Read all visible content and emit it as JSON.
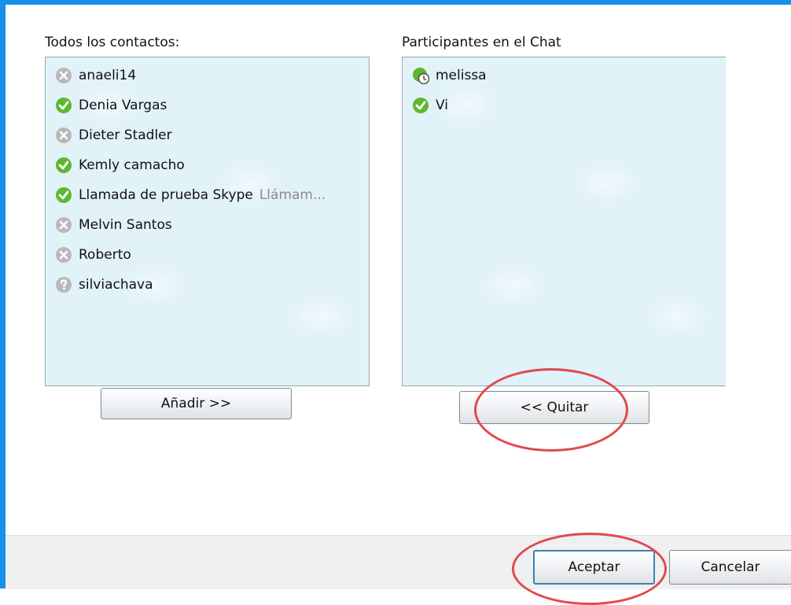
{
  "all_contacts": {
    "label": "Todos los contactos:",
    "items": [
      {
        "name": "anaeli14",
        "status": "offline",
        "mood": ""
      },
      {
        "name": "Denia Vargas",
        "status": "online",
        "mood": ""
      },
      {
        "name": "Dieter Stadler",
        "status": "offline",
        "mood": ""
      },
      {
        "name": "Kemly camacho",
        "status": "online",
        "mood": ""
      },
      {
        "name": "Llamada de prueba Skype",
        "status": "online",
        "mood": "Llámam..."
      },
      {
        "name": "Melvin Santos",
        "status": "offline",
        "mood": ""
      },
      {
        "name": "Roberto",
        "status": "offline",
        "mood": ""
      },
      {
        "name": "silviachava",
        "status": "unknown",
        "mood": ""
      }
    ]
  },
  "participants": {
    "label": "Participantes en el Chat",
    "items": [
      {
        "name": "melissa",
        "status": "away"
      },
      {
        "name": "Vi",
        "status": "online"
      }
    ]
  },
  "buttons": {
    "add": "Añadir >>",
    "remove": "<< Quitar",
    "ok": "Aceptar",
    "cancel": "Cancelar"
  },
  "colors": {
    "window_border": "#1591e8",
    "list_background": "#e1f2f9",
    "annotation": "#e04a4d",
    "online": "#5cb82e",
    "offline": "#b8b8b8"
  }
}
